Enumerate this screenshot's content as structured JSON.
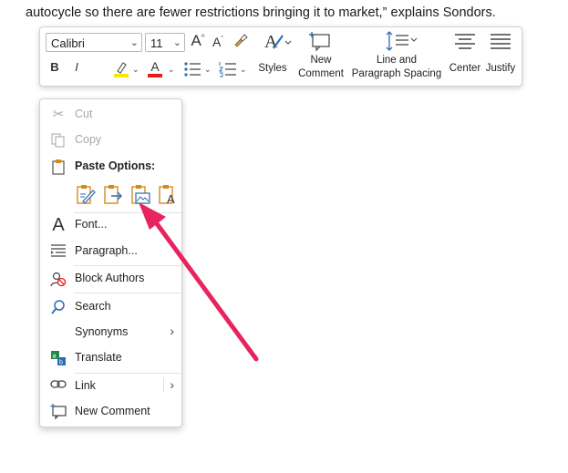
{
  "document": {
    "line_top_partial": "",
    "line": "autocycle so there are fewer restrictions bringing it to market,” explains Sondors."
  },
  "mini_toolbar": {
    "font_name": "Calibri",
    "font_size": "11",
    "styles_label": "Styles",
    "new_comment_label_1": "New",
    "new_comment_label_2": "Comment",
    "line_spacing_label_1": "Line and",
    "line_spacing_label_2": "Paragraph Spacing",
    "center_label": "Center",
    "justify_label": "Justify",
    "bold": "B",
    "italic": "I",
    "grow_font": "A",
    "shrink_font": "A",
    "font_color_letter": "A"
  },
  "context_menu": {
    "cut": "Cut",
    "copy": "Copy",
    "paste_options": "Paste Options:",
    "font": "Font...",
    "paragraph": "Paragraph...",
    "block_authors": "Block Authors",
    "search": "Search",
    "synonyms": "Synonyms",
    "translate": "Translate",
    "link": "Link",
    "new_comment": "New Comment"
  },
  "colors": {
    "annotation_arrow": "#e8245f",
    "highlight_yellow": "#f5e800",
    "font_color_red": "#e81b1b",
    "paste_icon_orange": "#d28b1f",
    "paste_icon_blue": "#2b6cb0"
  }
}
